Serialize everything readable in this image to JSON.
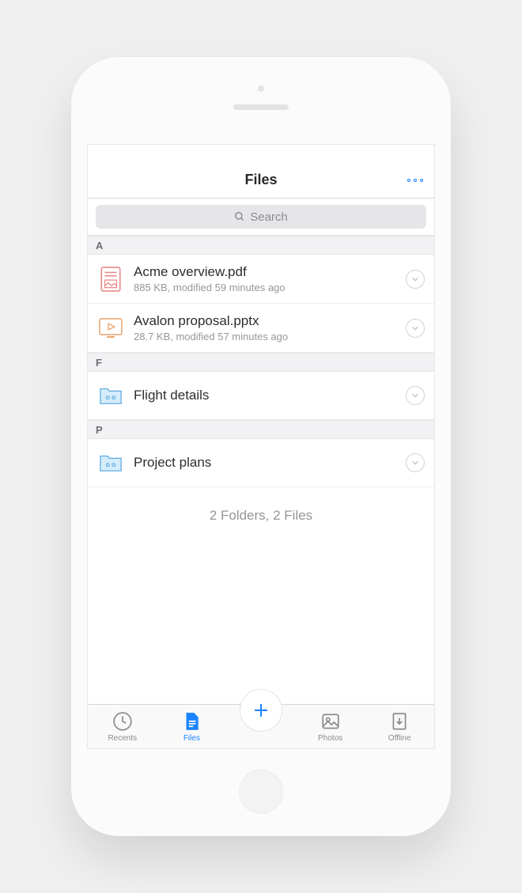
{
  "colors": {
    "accent": "#1a84ff"
  },
  "navbar": {
    "title": "Files"
  },
  "search": {
    "placeholder": "Search"
  },
  "sections": [
    {
      "letter": "A",
      "items": [
        {
          "name": "Acme overview.pdf",
          "meta": "885 KB, modified 59 minutes ago",
          "type": "pdf"
        },
        {
          "name": "Avalon proposal.pptx",
          "meta": "28.7 KB, modified 57 minutes ago",
          "type": "pptx"
        }
      ]
    },
    {
      "letter": "F",
      "items": [
        {
          "name": "Flight details",
          "type": "folder"
        }
      ]
    },
    {
      "letter": "P",
      "items": [
        {
          "name": "Project plans",
          "type": "folder"
        }
      ]
    }
  ],
  "summary": "2 Folders, 2 Files",
  "tabs": {
    "recents": "Recents",
    "files": "Files",
    "photos": "Photos",
    "offline": "Offline",
    "active": "files"
  }
}
